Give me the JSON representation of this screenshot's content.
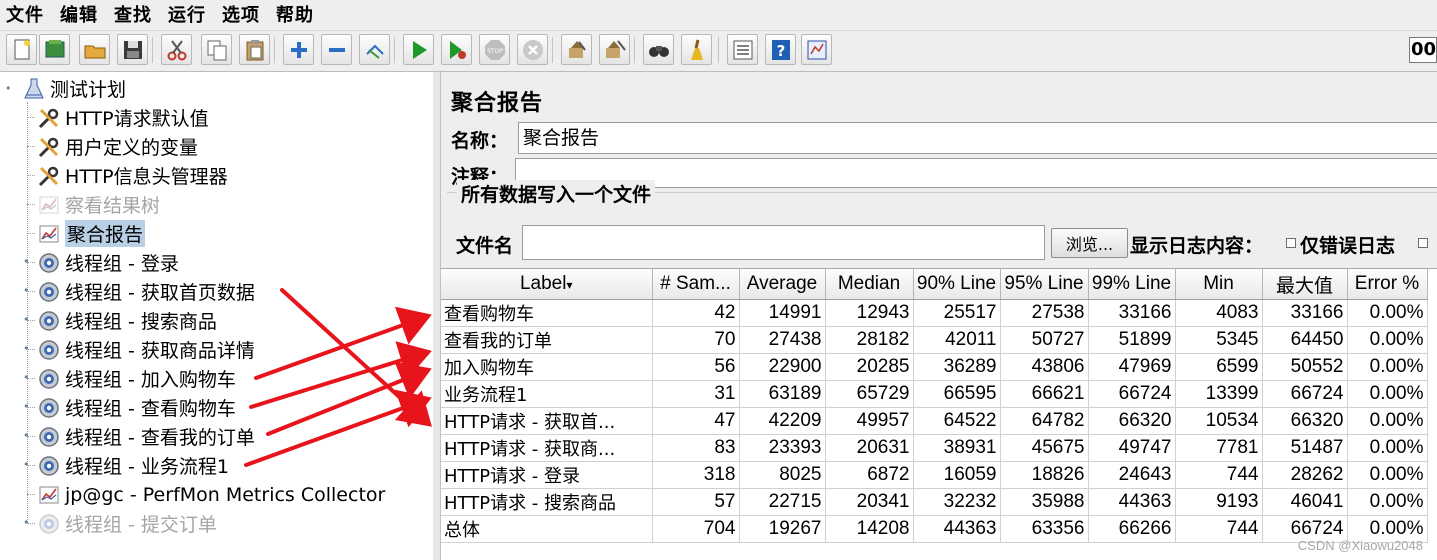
{
  "menu": [
    "文件",
    "编辑",
    "查找",
    "运行",
    "选项",
    "帮助"
  ],
  "toolbar": {
    "icons": [
      "new-icon",
      "templates-icon",
      "open-icon",
      "save-icon",
      "cut-icon",
      "copy-icon",
      "paste-icon",
      "expand-icon",
      "collapse-icon",
      "toggle-icon",
      "start-icon",
      "start-no-pause-icon",
      "stop-icon",
      "shutdown-icon",
      "clear-icon",
      "clear-all-icon",
      "search-icon",
      "reset-search-icon",
      "function-helper-icon",
      "help-icon",
      "logger-icon"
    ],
    "counter": "00"
  },
  "tree": {
    "root": "测试计划",
    "items": [
      {
        "label": "HTTP请求默认值",
        "icon": "wrench-icon",
        "disabled": false,
        "selected": false
      },
      {
        "label": "用户定义的变量",
        "icon": "wrench-icon",
        "disabled": false,
        "selected": false
      },
      {
        "label": "HTTP信息头管理器",
        "icon": "wrench-icon",
        "disabled": false,
        "selected": false
      },
      {
        "label": "察看结果树",
        "icon": "graph-icon",
        "disabled": true,
        "selected": false
      },
      {
        "label": "聚合报告",
        "icon": "graph-icon",
        "disabled": false,
        "selected": true
      },
      {
        "label": "线程组 - 登录",
        "icon": "gear-icon",
        "disabled": false,
        "selected": false
      },
      {
        "label": "线程组 - 获取首页数据",
        "icon": "gear-icon",
        "disabled": false,
        "selected": false
      },
      {
        "label": "线程组 - 搜索商品",
        "icon": "gear-icon",
        "disabled": false,
        "selected": false
      },
      {
        "label": "线程组 - 获取商品详情",
        "icon": "gear-icon",
        "disabled": false,
        "selected": false
      },
      {
        "label": "线程组 - 加入购物车",
        "icon": "gear-icon",
        "disabled": false,
        "selected": false
      },
      {
        "label": "线程组 - 查看购物车",
        "icon": "gear-icon",
        "disabled": false,
        "selected": false
      },
      {
        "label": "线程组 - 查看我的订单",
        "icon": "gear-icon",
        "disabled": false,
        "selected": false
      },
      {
        "label": "线程组 - 业务流程1",
        "icon": "gear-icon",
        "disabled": false,
        "selected": false
      },
      {
        "label": "jp@gc - PerfMon Metrics Collector",
        "icon": "graph-icon",
        "disabled": false,
        "selected": false
      },
      {
        "label": "线程组 - 提交订单",
        "icon": "gear-icon",
        "disabled": true,
        "selected": false
      }
    ]
  },
  "panel": {
    "title": "聚合报告",
    "name_label": "名称：",
    "name_value": "聚合报告",
    "comment_label": "注释：",
    "comment_value": "",
    "file_group_title": "所有数据写入一个文件",
    "filename_label": "文件名",
    "filename_value": "",
    "browse_label": "浏览...",
    "log_label": "显示日志内容：",
    "errors_only_label": "仅错误日志",
    "errors_only_checked": false
  },
  "table": {
    "columns": [
      "Label",
      "# Sam...",
      "Average",
      "Median",
      "90% Line",
      "95% Line",
      "99% Line",
      "Min",
      "最大值",
      "Error %"
    ],
    "sort_indicator": "▾",
    "rows": [
      [
        "查看购物车",
        "42",
        "14991",
        "12943",
        "25517",
        "27538",
        "33166",
        "4083",
        "33166",
        "0.00%"
      ],
      [
        "查看我的订单",
        "70",
        "27438",
        "28182",
        "42011",
        "50727",
        "51899",
        "5345",
        "64450",
        "0.00%"
      ],
      [
        "加入购物车",
        "56",
        "22900",
        "20285",
        "36289",
        "43806",
        "47969",
        "6599",
        "50552",
        "0.00%"
      ],
      [
        "业务流程1",
        "31",
        "63189",
        "65729",
        "66595",
        "66621",
        "66724",
        "13399",
        "66724",
        "0.00%"
      ],
      [
        "HTTP请求 - 获取首...",
        "47",
        "42209",
        "49957",
        "64522",
        "64782",
        "66320",
        "10534",
        "66320",
        "0.00%"
      ],
      [
        "HTTP请求 - 获取商...",
        "83",
        "23393",
        "20631",
        "38931",
        "45675",
        "49747",
        "7781",
        "51487",
        "0.00%"
      ],
      [
        "HTTP请求 - 登录",
        "318",
        "8025",
        "6872",
        "16059",
        "18826",
        "24643",
        "744",
        "28262",
        "0.00%"
      ],
      [
        "HTTP请求 - 搜索商品",
        "57",
        "22715",
        "20341",
        "32232",
        "35988",
        "44363",
        "9193",
        "46041",
        "0.00%"
      ],
      [
        "总体",
        "704",
        "19267",
        "14208",
        "44363",
        "63356",
        "66266",
        "744",
        "66724",
        "0.00%"
      ]
    ]
  },
  "annotation_color": "#e8141c",
  "watermark": "CSDN @Xiaowu2048"
}
